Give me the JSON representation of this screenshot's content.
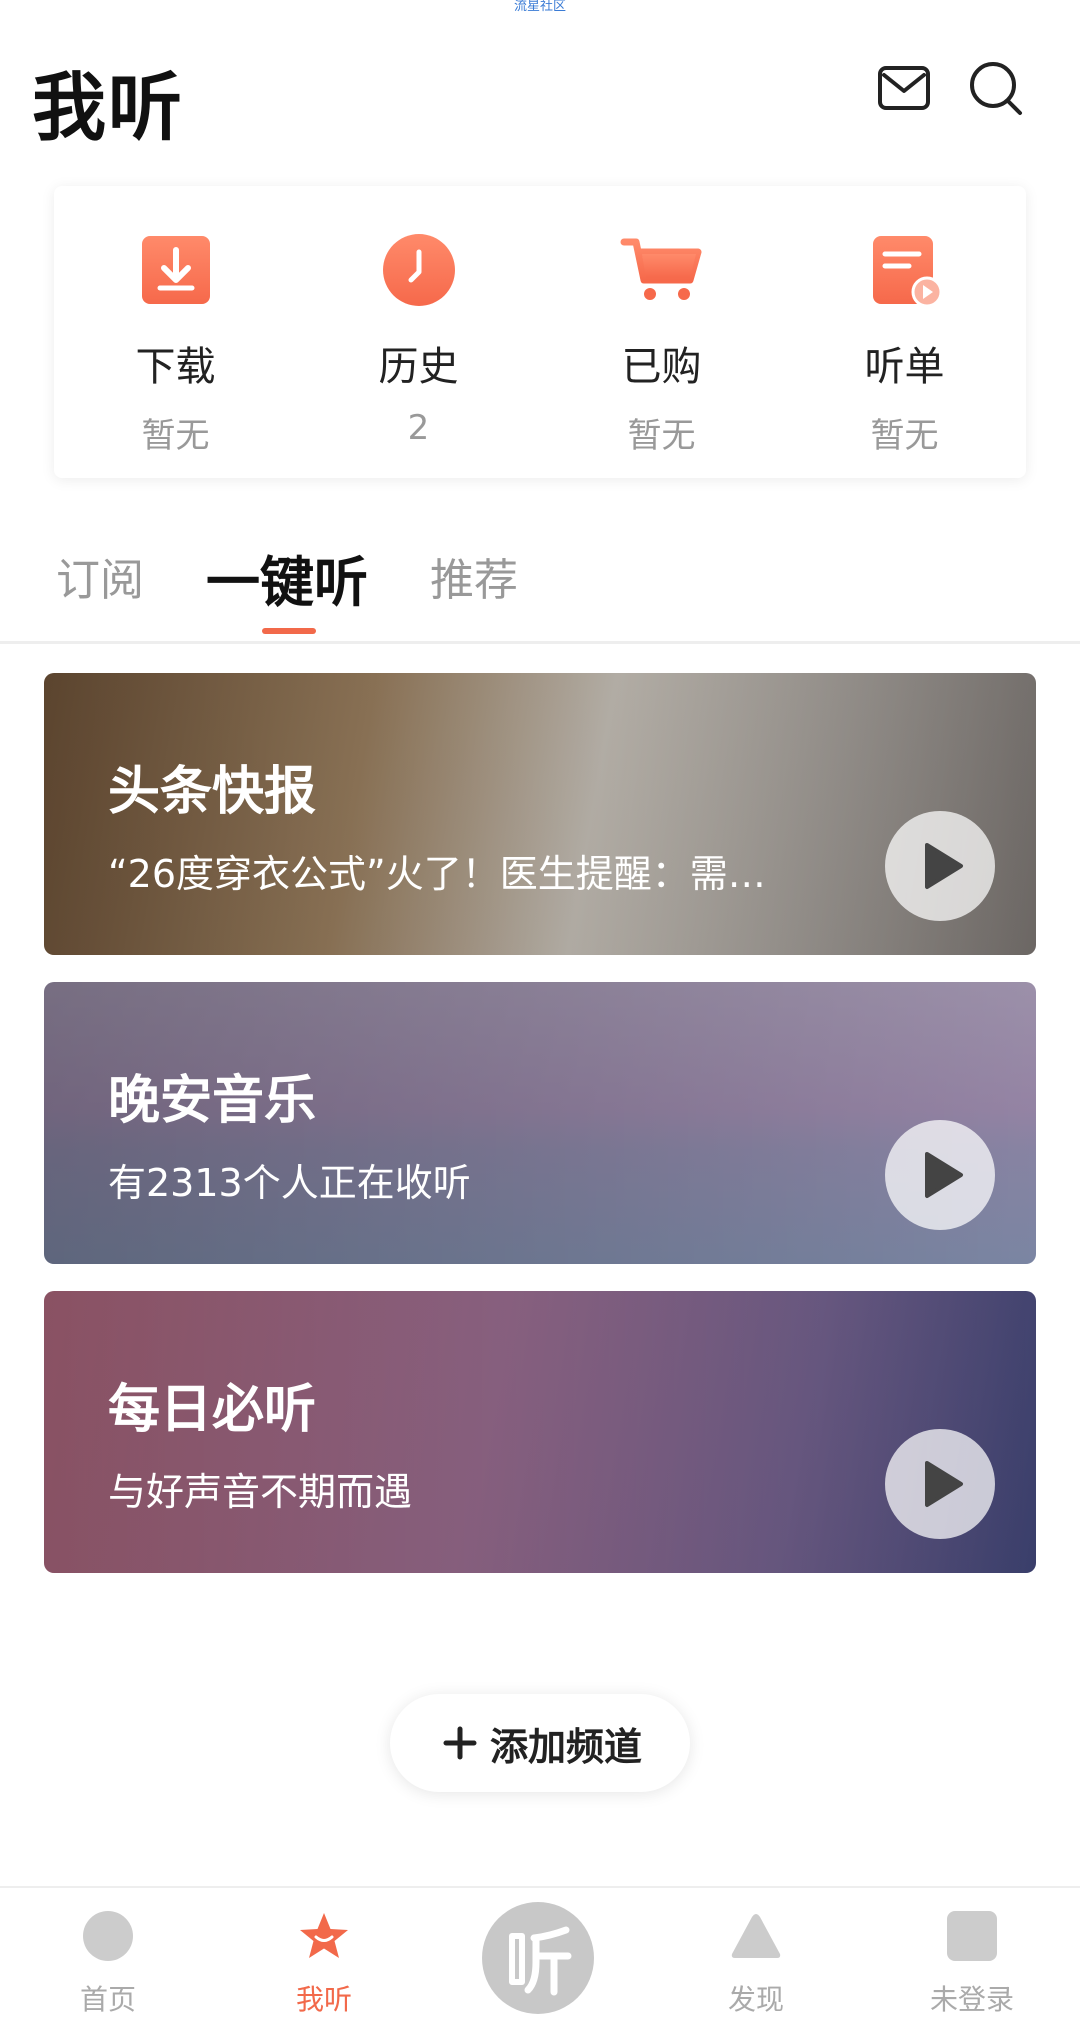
{
  "watermark": "流星社区",
  "header": {
    "title": "我听"
  },
  "quick": [
    {
      "label": "下载",
      "sub": "暂无",
      "icon": "download-icon"
    },
    {
      "label": "历史",
      "sub": "2",
      "icon": "clock-icon"
    },
    {
      "label": "已购",
      "sub": "暂无",
      "icon": "cart-icon"
    },
    {
      "label": "听单",
      "sub": "暂无",
      "icon": "playlist-icon"
    }
  ],
  "tabs": {
    "subscribe": "订阅",
    "one_key": "一键听",
    "recommend": "推荐"
  },
  "channels": [
    {
      "title": "头条快报",
      "subtitle": "“26度穿衣公式”火了！医生提醒：需…"
    },
    {
      "title": "晚安音乐",
      "subtitle": "有2313个人正在收听"
    },
    {
      "title": "每日必听",
      "subtitle": "与好声音不期而遇"
    }
  ],
  "add_channel": {
    "label": "添加频道"
  },
  "nav": [
    {
      "label": "首页"
    },
    {
      "label": "我听"
    },
    {
      "label": ""
    },
    {
      "label": "发现"
    },
    {
      "label": "未登录"
    }
  ],
  "colors": {
    "accent": "#f2694a",
    "inactive": "#aaaaaa"
  }
}
